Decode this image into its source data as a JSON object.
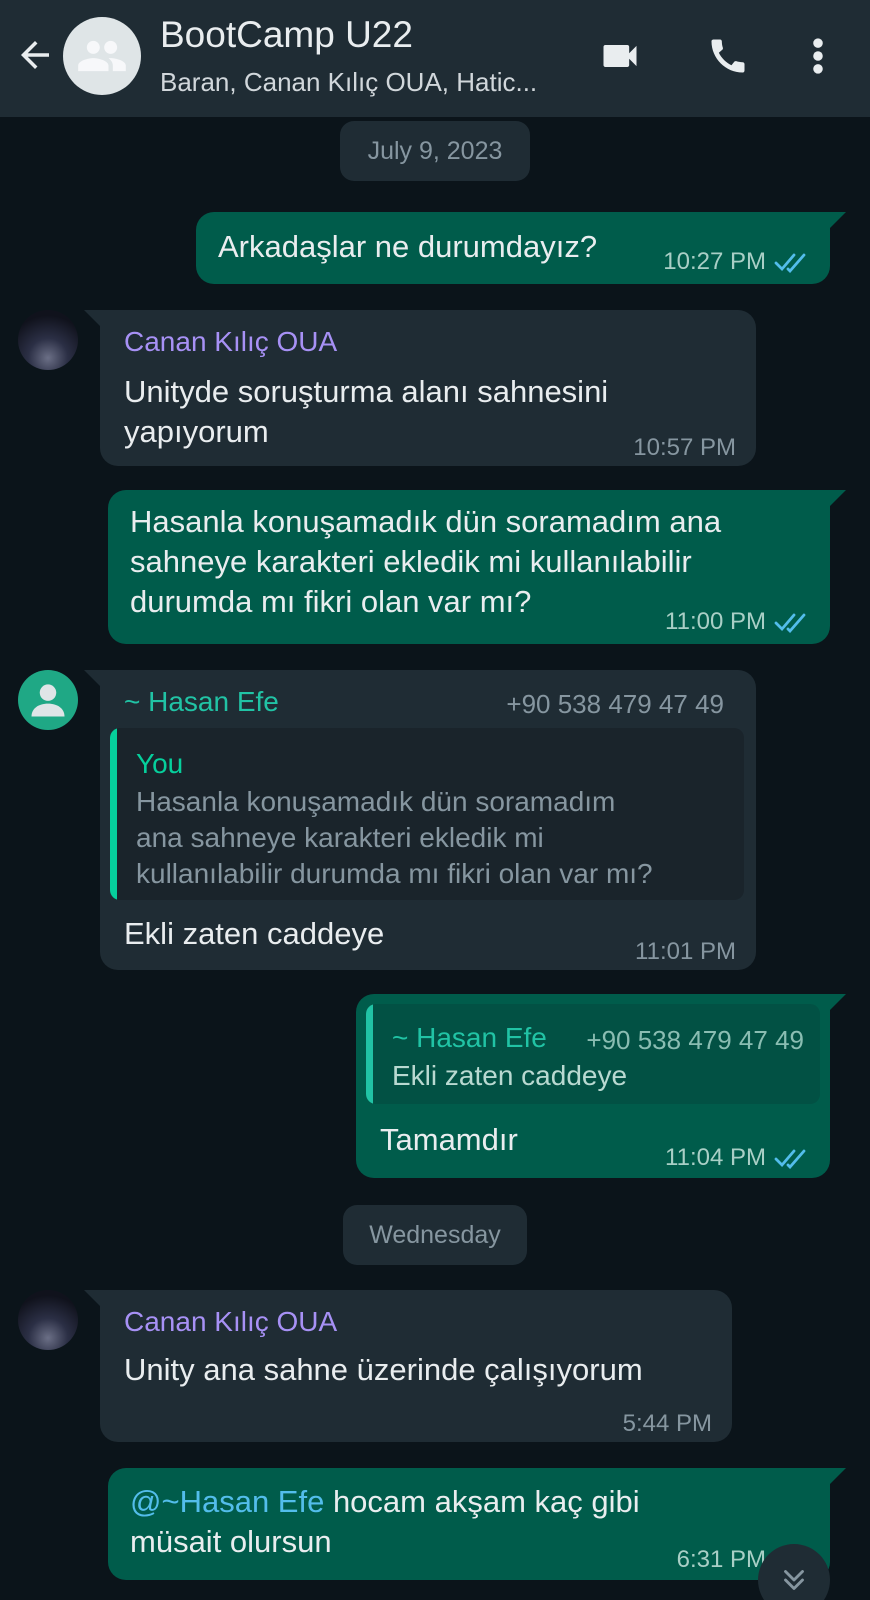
{
  "header": {
    "title": "BootCamp U22",
    "subtitle": "Baran, Canan Kılıç OUA, Hatic..."
  },
  "date_chips": {
    "first": "July 9, 2023",
    "second": "Wednesday"
  },
  "messages": [
    {
      "direction": "out",
      "text": "Arkadaşlar ne durumdayız?",
      "time": "10:27 PM",
      "status": "read"
    },
    {
      "direction": "in",
      "sender": "Canan Kılıç OUA",
      "lines": [
        "Unityde soruşturma alanı sahnesini",
        "yapıyorum"
      ],
      "time": "10:57 PM"
    },
    {
      "direction": "out",
      "lines": [
        "Hasanla konuşamadık dün soramadım ana",
        "sahneye karakteri ekledik mi kullanılabilir",
        "durumda mı fikri olan var mı?"
      ],
      "time": "11:00 PM",
      "status": "read"
    },
    {
      "direction": "in",
      "sender": "~ Hasan Efe",
      "sender_phone": "+90 538 479 47 49",
      "quote": {
        "name": "You",
        "lines": [
          "Hasanla konuşamadık dün soramadım",
          "ana sahneye karakteri ekledik mi",
          "kullanılabilir durumda mı fikri olan var mı?"
        ]
      },
      "text": "Ekli zaten caddeye",
      "time": "11:01 PM"
    },
    {
      "direction": "out",
      "quote": {
        "name": "~ Hasan Efe",
        "phone": "+90 538 479 47 49",
        "text": "Ekli zaten caddeye"
      },
      "text": "Tamamdır",
      "time": "11:04 PM",
      "status": "read"
    },
    {
      "direction": "in",
      "sender": "Canan Kılıç OUA",
      "text": "Unity ana sahne üzerinde çalışıyorum",
      "time": "5:44 PM"
    },
    {
      "direction": "out",
      "mention": "@~Hasan Efe",
      "line1_rest": " hocam akşam kaç gibi",
      "line2": "müsait olursun",
      "time": "6:31 PM",
      "status": "read"
    }
  ],
  "colors": {
    "background": "#0b141a",
    "header": "#1f2c34",
    "outgoing_bubble": "#005c4b",
    "incoming_bubble": "#1f2c34",
    "read_ticks": "#53bdeb"
  },
  "icons": [
    "back-arrow-icon",
    "group-avatar-icon",
    "video-call-icon",
    "phone-call-icon",
    "more-options-icon",
    "double-check-icon",
    "default-person-avatar-icon",
    "scroll-down-icon"
  ]
}
